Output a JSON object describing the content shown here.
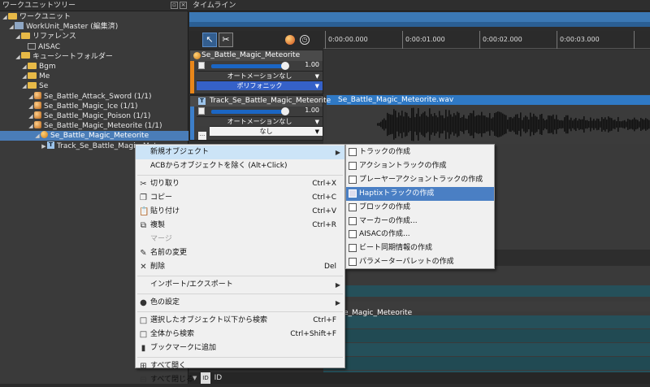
{
  "tree": {
    "title": "ワークユニットツリー",
    "items": [
      {
        "label": "ワークユニット",
        "indent": 0,
        "kind": "folder"
      },
      {
        "label": "WorkUnit_Master (編集済)",
        "indent": 1,
        "kind": "unit"
      },
      {
        "label": "リファレンス",
        "indent": 2,
        "kind": "folder"
      },
      {
        "label": "AISAC",
        "indent": 3,
        "kind": "aisac"
      },
      {
        "label": "キューシートフォルダー",
        "indent": 2,
        "kind": "folder"
      },
      {
        "label": "Bgm",
        "indent": 3,
        "kind": "folder"
      },
      {
        "label": "Me",
        "indent": 3,
        "kind": "folder"
      },
      {
        "label": "Se",
        "indent": 3,
        "kind": "folder"
      },
      {
        "label": "Se_Battle_Attack_Sword (1/1)",
        "indent": 4,
        "kind": "cuesheet"
      },
      {
        "label": "Se_Battle_Magic_Ice (1/1)",
        "indent": 4,
        "kind": "cuesheet"
      },
      {
        "label": "Se_Battle_Magic_Poison (1/1)",
        "indent": 4,
        "kind": "cuesheet"
      },
      {
        "label": "Se_Battle_Magic_Meteorite (1/1)",
        "indent": 4,
        "kind": "cuesheet"
      },
      {
        "label": "Se_Battle_Magic_Meteorite",
        "indent": 5,
        "kind": "cue",
        "selected": true
      },
      {
        "label": "Track_Se_Battle_Magic_Mete",
        "indent": 6,
        "kind": "track"
      }
    ]
  },
  "timeline": {
    "title": "タイムライン",
    "ruler": [
      "0:00:00.000",
      "0:00:01.000",
      "0:00:02.000",
      "0:00:03.000"
    ],
    "cue": {
      "name": "Se_Battle_Magic_Meteorite",
      "volume": "1.00",
      "automation": "オートメーションなし",
      "mode": "ポリフォニック"
    },
    "track": {
      "name": "Track_Se_Battle_Magic_Meteorite",
      "volume": "1.00",
      "automation": "オートメーションなし",
      "option": "なし"
    },
    "waveform_file": "Se_Battle_Magic_Meteorite.wav",
    "bottom_text": "e_Magic_Meteorite",
    "id_label": "ID"
  },
  "context_menu": {
    "items": [
      {
        "label": "新規オブジェクト",
        "submenu": true,
        "highlight": true
      },
      {
        "label": "ACBからオブジェクトを除く (Alt+Click)"
      },
      {
        "sep": true
      },
      {
        "label": "切り取り",
        "shortcut": "Ctrl+X",
        "icon": "✂"
      },
      {
        "label": "コピー",
        "shortcut": "Ctrl+C",
        "icon": "❐"
      },
      {
        "label": "貼り付け",
        "shortcut": "Ctrl+V",
        "icon": "📋"
      },
      {
        "label": "複製",
        "shortcut": "Ctrl+R",
        "icon": "⧉"
      },
      {
        "label": "マージ",
        "disabled": true
      },
      {
        "label": "名前の変更",
        "icon": "✎"
      },
      {
        "label": "削除",
        "shortcut": "Del",
        "icon": "✕"
      },
      {
        "sep": true
      },
      {
        "label": "インポート/エクスポート",
        "submenu": true
      },
      {
        "sep": true
      },
      {
        "label": "色の設定",
        "submenu": true,
        "icon": "●"
      },
      {
        "sep": true
      },
      {
        "label": "選択したオブジェクト以下から検索",
        "shortcut": "Ctrl+F",
        "icon": "□"
      },
      {
        "label": "全体から検索",
        "shortcut": "Ctrl+Shift+F",
        "icon": "□"
      },
      {
        "label": "ブックマークに追加",
        "icon": "▮"
      },
      {
        "sep": true
      },
      {
        "label": "すべて開く",
        "icon": "⊞"
      },
      {
        "label": "すべて閉じる",
        "icon": "⊟"
      }
    ]
  },
  "submenu": {
    "items": [
      {
        "label": "トラックの作成"
      },
      {
        "label": "アクショントラックの作成"
      },
      {
        "label": "プレーヤーアクショントラックの作成"
      },
      {
        "label": "Haptixトラックの作成",
        "highlight": true
      },
      {
        "label": "ブロックの作成"
      },
      {
        "label": "マーカーの作成..."
      },
      {
        "label": "AISACの作成..."
      },
      {
        "label": "ビート同期情報の作成"
      },
      {
        "label": "パラメーターパレットの作成"
      }
    ]
  }
}
